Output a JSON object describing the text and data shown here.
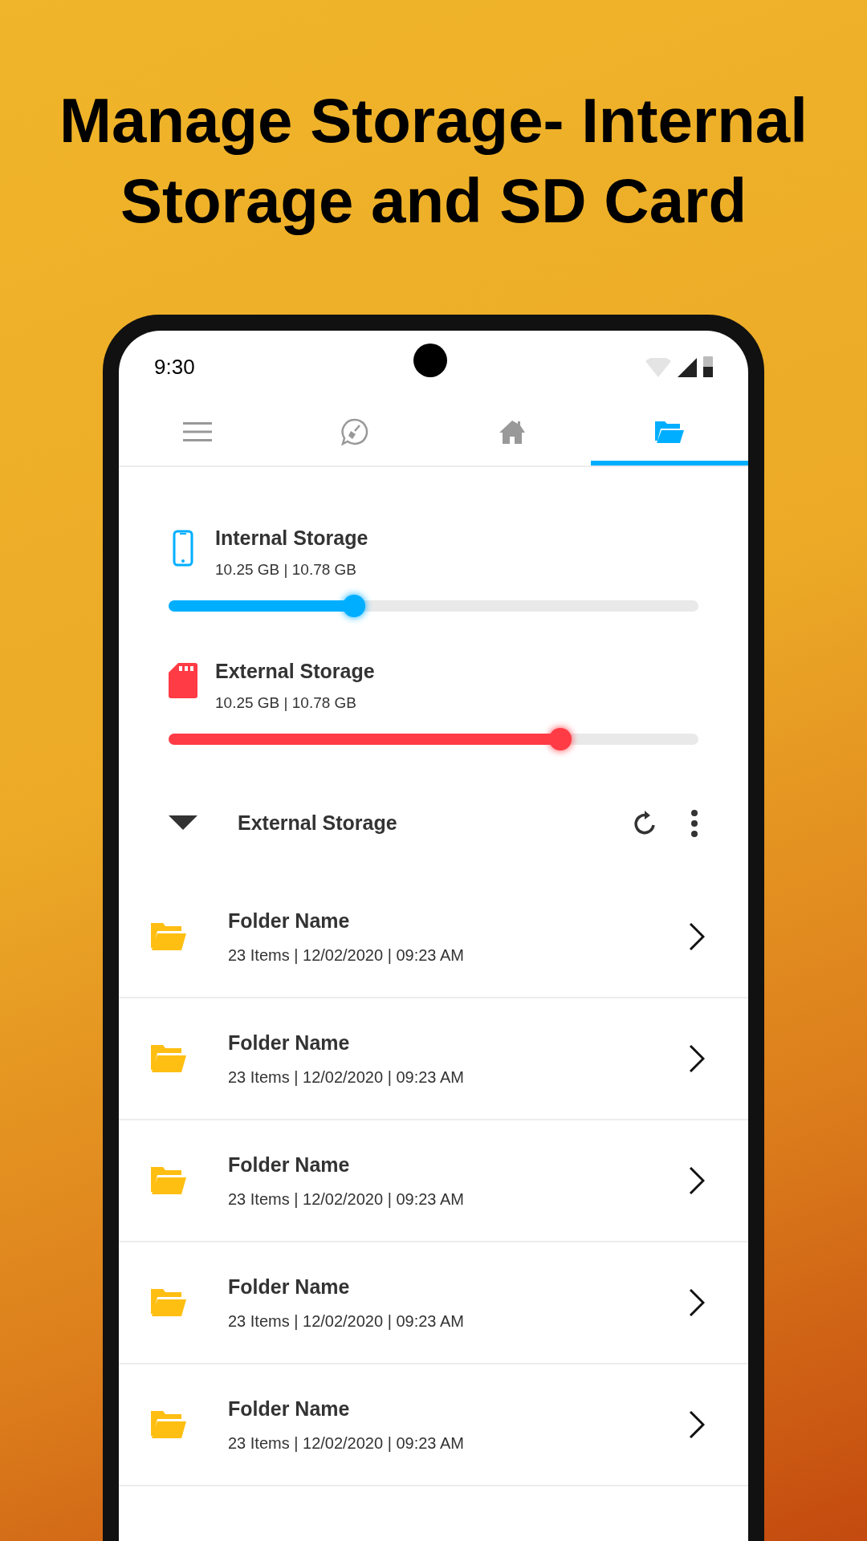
{
  "headline": "Manage Storage- Internal Storage and SD Card",
  "status_bar": {
    "time": "9:30"
  },
  "tabs": [
    {
      "kind": "menu",
      "selected": false
    },
    {
      "kind": "cleaner",
      "selected": false
    },
    {
      "kind": "home",
      "selected": false
    },
    {
      "kind": "folder",
      "selected": true
    }
  ],
  "storages": [
    {
      "kind": "phone",
      "name": "Internal Storage",
      "usage": "10.25 GB | 10.78 GB",
      "level": 0.35,
      "color": "#00aeff"
    },
    {
      "kind": "sdcard",
      "name": "External Storage",
      "usage": "10.25 GB | 10.78 GB",
      "level": 0.74,
      "color": "#ff3b45"
    }
  ],
  "section": {
    "title": "External Storage",
    "expanded": true
  },
  "folders": [
    {
      "name": "Folder Name",
      "details": "23 Items | 12/02/2020 | 09:23 AM"
    },
    {
      "name": "Folder Name",
      "details": "23 Items | 12/02/2020 | 09:23 AM"
    },
    {
      "name": "Folder Name",
      "details": "23 Items | 12/02/2020 | 09:23 AM"
    },
    {
      "name": "Folder Name",
      "details": "23 Items | 12/02/2020 | 09:23 AM"
    },
    {
      "name": "Folder Name",
      "details": "23 Items | 12/02/2020 | 09:23 AM"
    }
  ]
}
